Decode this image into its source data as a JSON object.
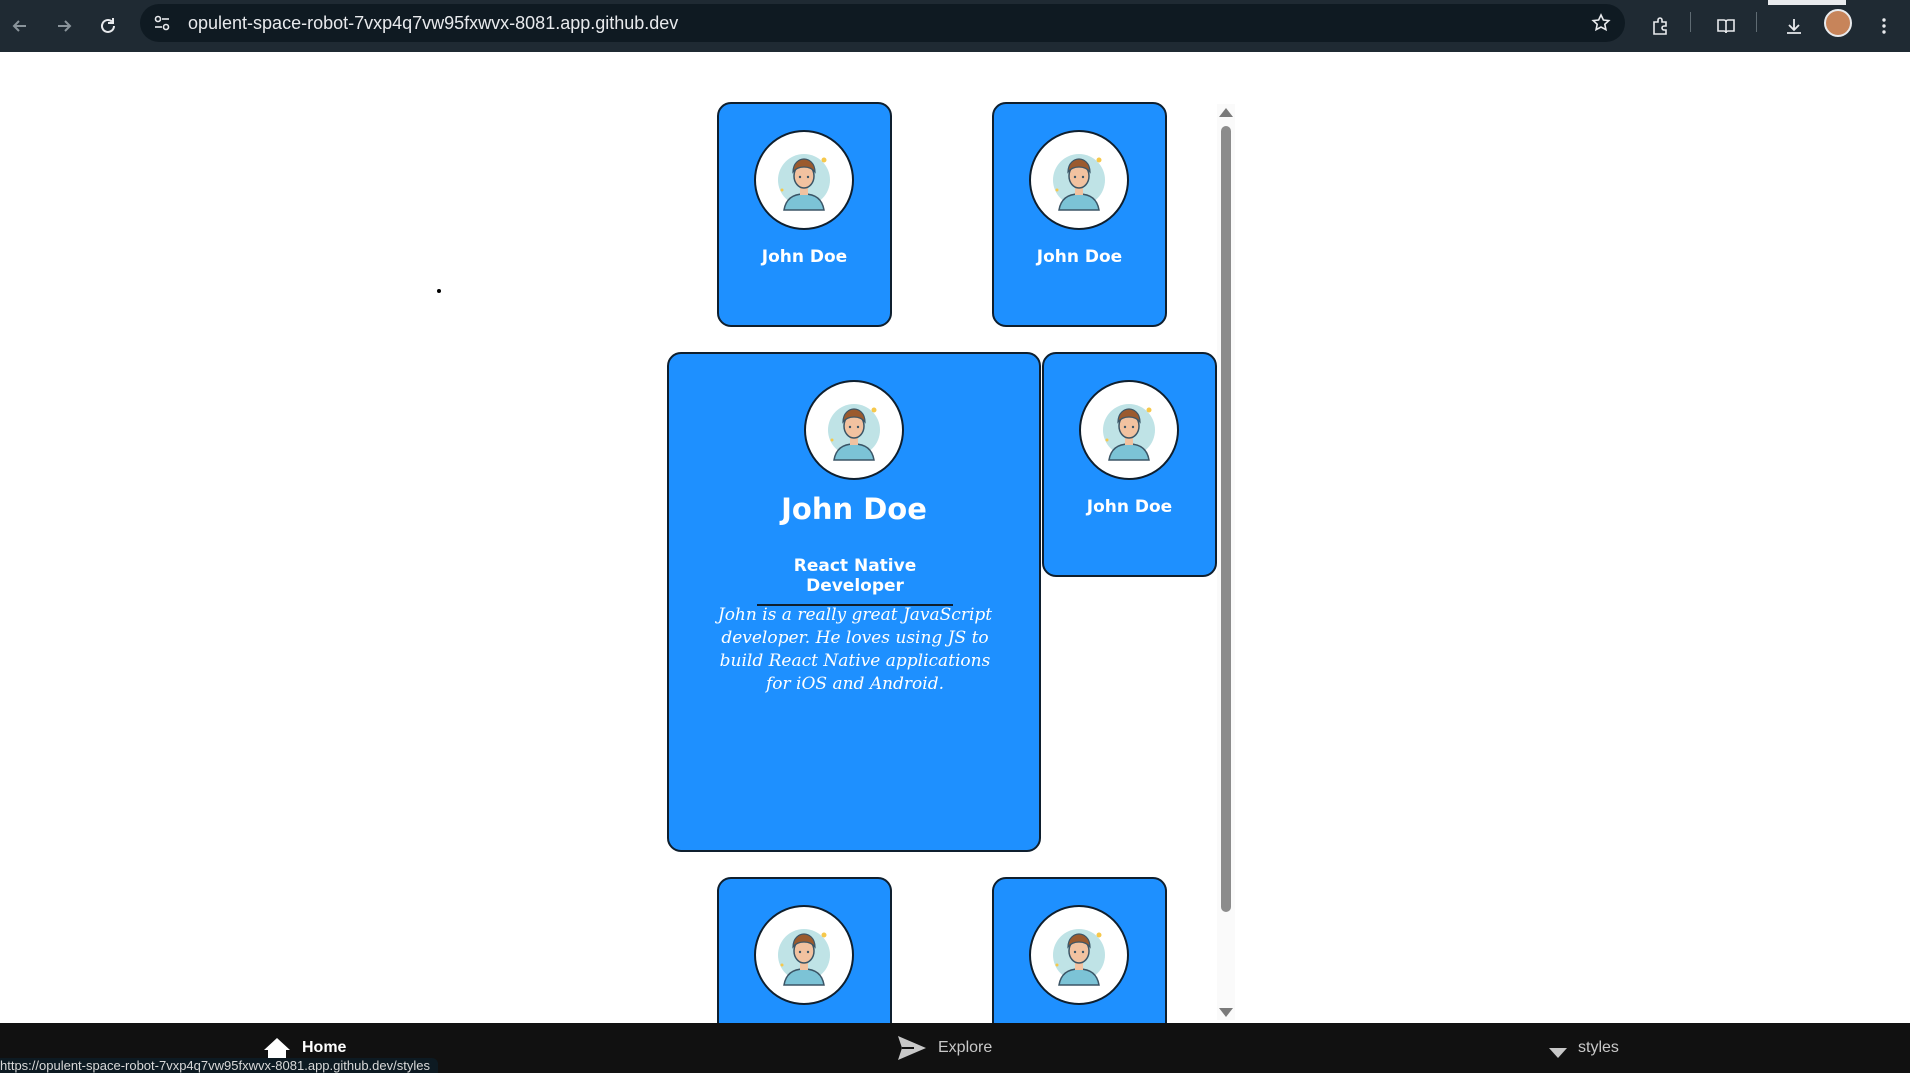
{
  "browser": {
    "url": "opulent-space-robot-7vxp4q7vw95fxwvx-8081.app.github.dev",
    "status_url": "https://opulent-space-robot-7vxp4q7vw95fxwvx-8081.app.github.dev/styles"
  },
  "cards": {
    "small_name": "John Doe",
    "expanded": {
      "name": "John Doe",
      "role": "React Native Developer",
      "bio": "John is a really great JavaScript developer. He loves using JS to build React Native applications for iOS and Android."
    }
  },
  "bottom_nav": {
    "home": "Home",
    "explore": "Explore",
    "styles": "styles"
  },
  "colors": {
    "card_bg": "#1e90ff",
    "toolbar_bg": "#1f2a33",
    "nav_bg": "#111111"
  }
}
